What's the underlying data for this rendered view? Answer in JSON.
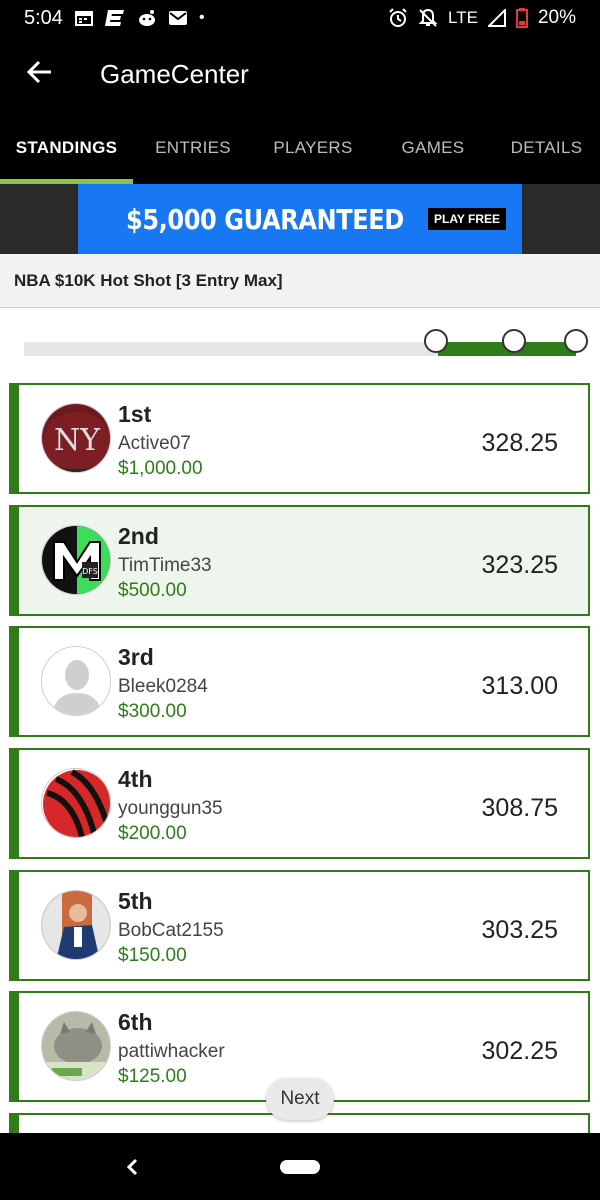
{
  "status_bar": {
    "time": "5:04",
    "network": "LTE",
    "battery": "20%",
    "dot": "•",
    "icons": [
      "calendar-icon",
      "espn-icon",
      "reddit-icon",
      "mail-icon",
      "alarm-icon",
      "notifications-off-icon",
      "signal-icon",
      "battery-icon"
    ]
  },
  "app_bar": {
    "title": "GameCenter",
    "back_icon": "arrow-back-icon"
  },
  "tabs": [
    {
      "label": "STANDINGS",
      "active": true
    },
    {
      "label": "ENTRIES",
      "active": false
    },
    {
      "label": "PLAYERS",
      "active": false
    },
    {
      "label": "GAMES",
      "active": false
    },
    {
      "label": "DETAILS",
      "active": false
    }
  ],
  "banner": {
    "text": "$5,000 GUARANTEED",
    "cta": "PLAY FREE",
    "color": "#1877f2"
  },
  "contest": {
    "title": "NBA $10K Hot Shot [3 Entry Max]"
  },
  "progress": {
    "filled_fraction": 0.25
  },
  "standings": [
    {
      "rank": "1st",
      "user": "Active07",
      "prize": "$1,000.00",
      "score": "328.25",
      "avatar": "yankees-cap-avatar",
      "highlight": false
    },
    {
      "rank": "2nd",
      "user": "TimTime33",
      "prize": "$500.00",
      "score": "323.25",
      "avatar": "dfs-logo-avatar",
      "highlight": true
    },
    {
      "rank": "3rd",
      "user": "Bleek0284",
      "prize": "$300.00",
      "score": "313.00",
      "avatar": "default-user-avatar",
      "highlight": false
    },
    {
      "rank": "4th",
      "user": "younggun35",
      "prize": "$200.00",
      "score": "308.75",
      "avatar": "raptors-ball-avatar",
      "highlight": false
    },
    {
      "rank": "5th",
      "user": "BobCat2155",
      "prize": "$150.00",
      "score": "303.25",
      "avatar": "photo-person-avatar",
      "highlight": false
    },
    {
      "rank": "6th",
      "user": "pattiwhacker",
      "prize": "$125.00",
      "score": "302.25",
      "avatar": "cat-photo-avatar",
      "highlight": false
    }
  ],
  "pager": {
    "next_label": "Next"
  },
  "colors": {
    "accent_green": "#2e7d1a",
    "tab_indicator": "#8bc34a"
  },
  "nav_bar": {
    "back_icon": "nav-back-icon",
    "home_icon": "nav-home-pill"
  }
}
